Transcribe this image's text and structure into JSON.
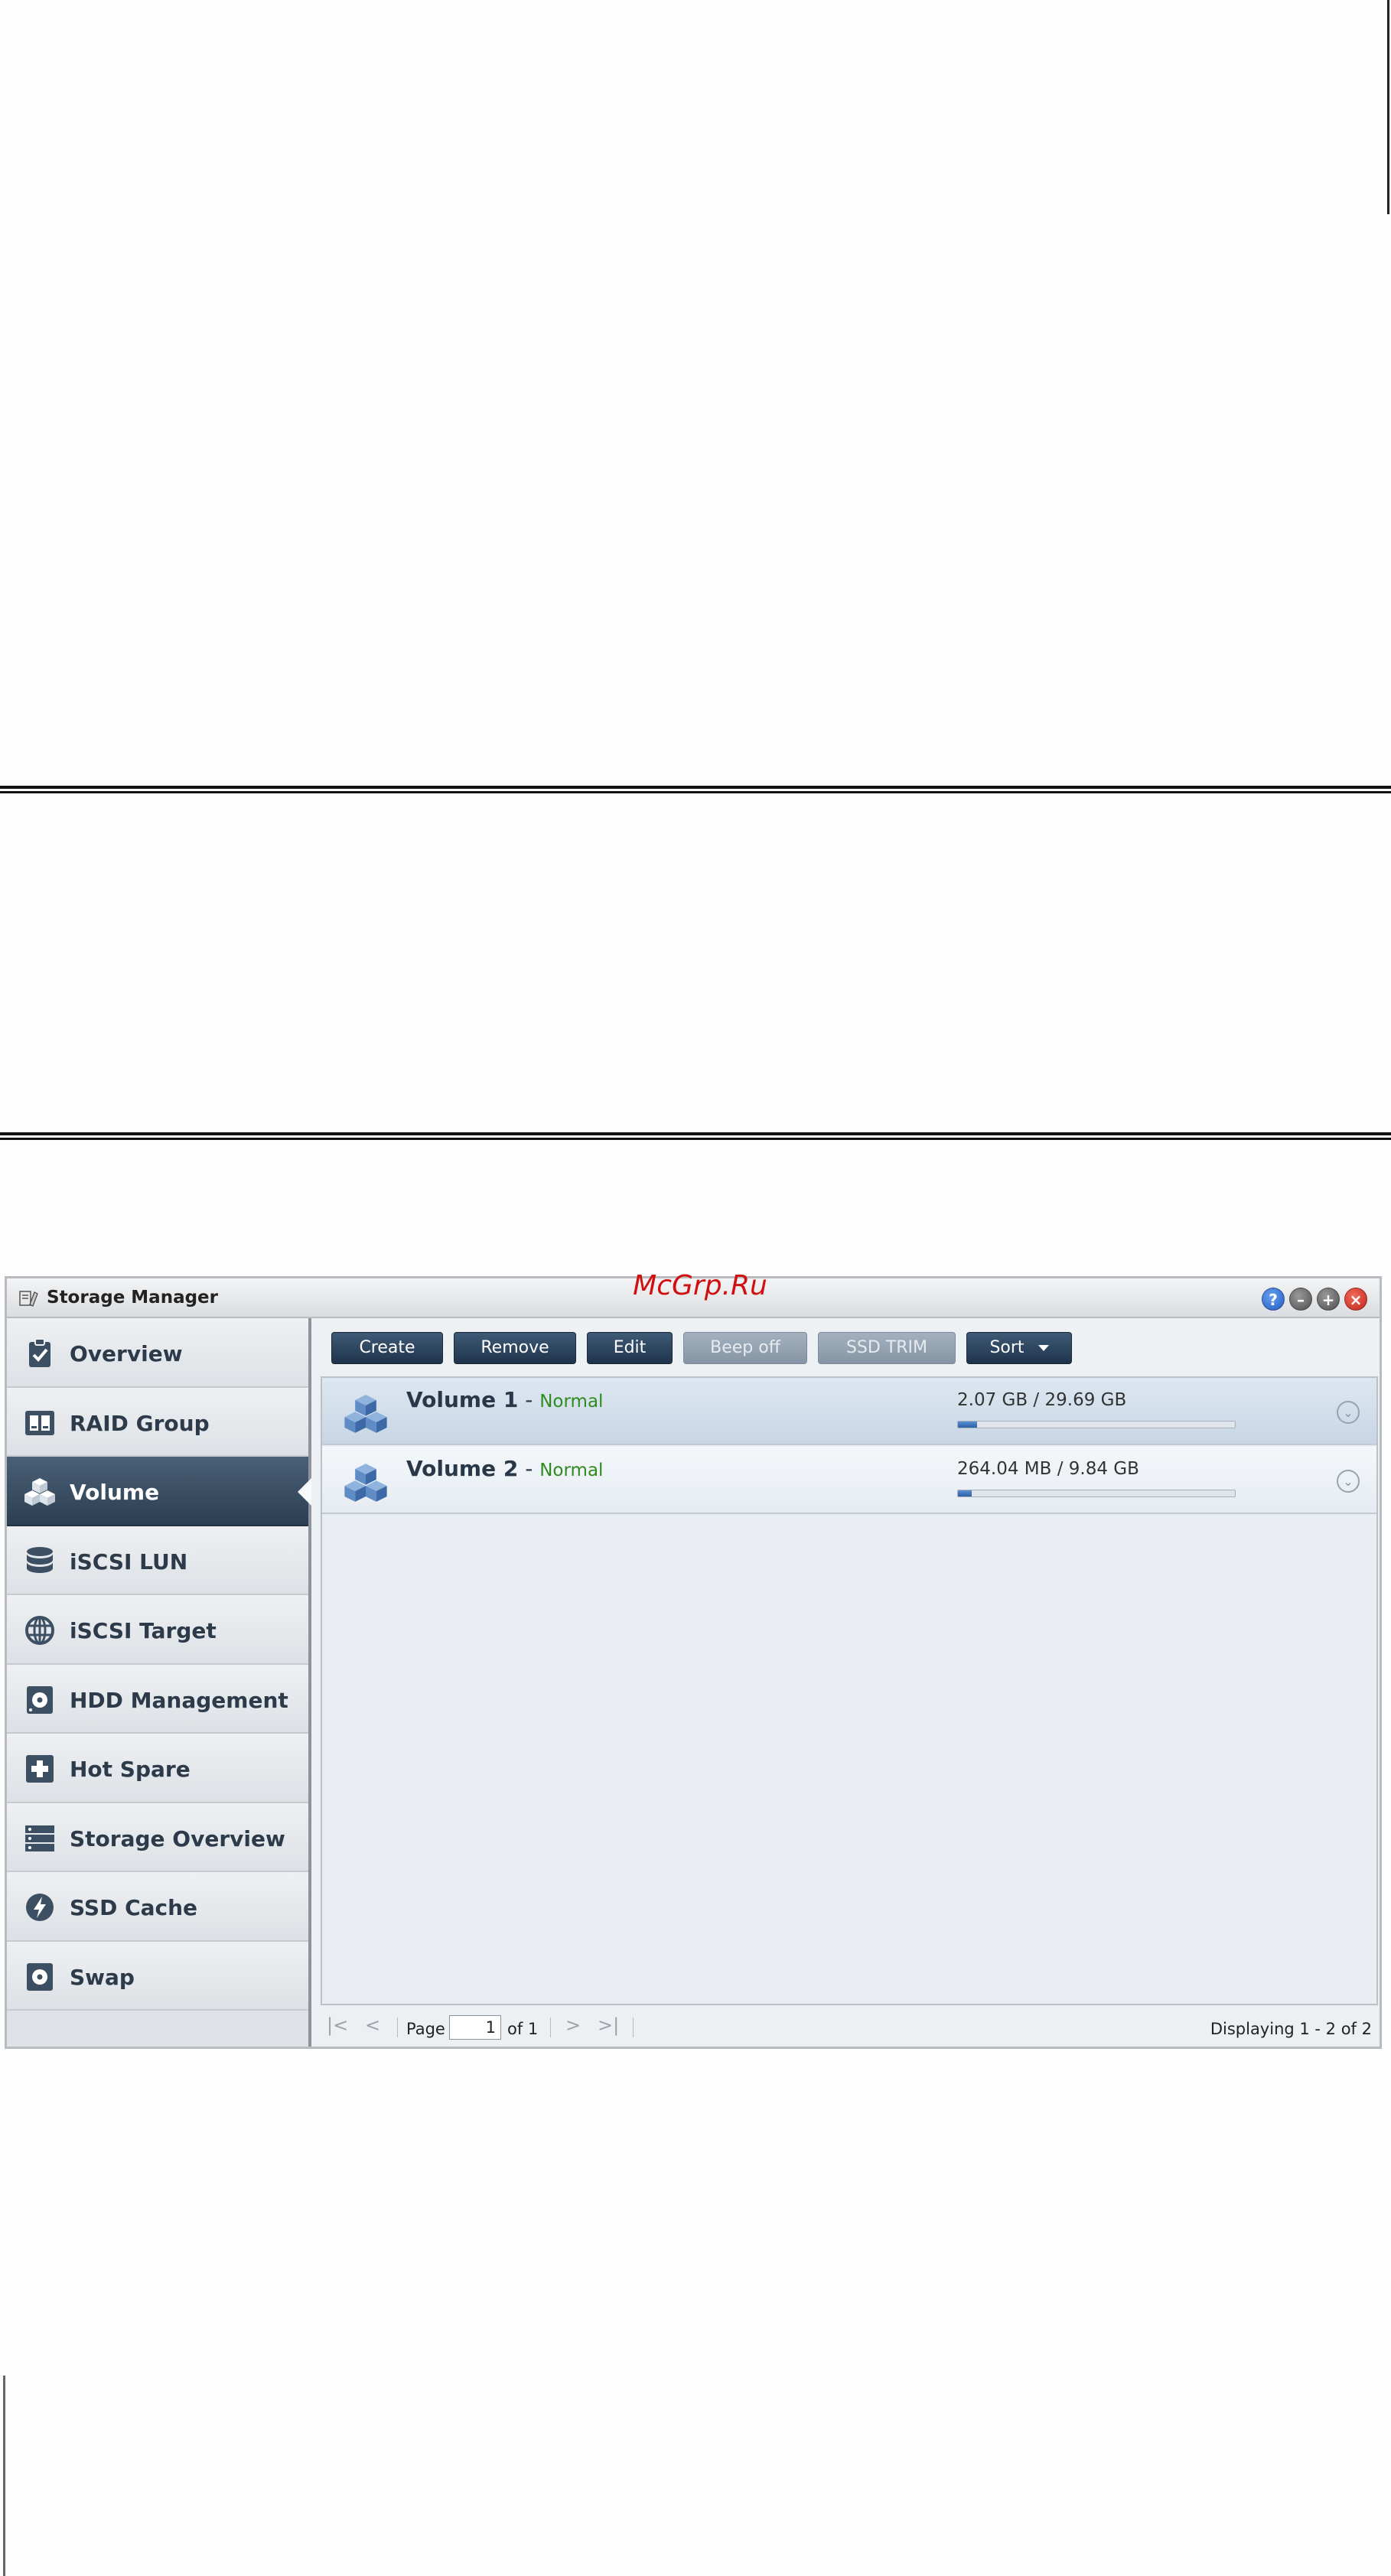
{
  "watermark": "McGrp.Ru",
  "window": {
    "title": "Storage Manager",
    "controls": [
      {
        "name": "help-icon",
        "glyph": "?"
      },
      {
        "name": "minimize-icon",
        "glyph": "–"
      },
      {
        "name": "maximize-icon",
        "glyph": "+"
      },
      {
        "name": "close-icon",
        "glyph": "×"
      }
    ]
  },
  "sidebar": {
    "items": [
      {
        "label": "Overview",
        "icon": "clipboard-check-icon"
      },
      {
        "label": "RAID Group",
        "icon": "raid-group-icon"
      },
      {
        "label": "Volume",
        "icon": "volume-cubes-icon",
        "active": true
      },
      {
        "label": "iSCSI LUN",
        "icon": "database-icon"
      },
      {
        "label": "iSCSI Target",
        "icon": "globe-icon"
      },
      {
        "label": "HDD Management",
        "icon": "hdd-icon"
      },
      {
        "label": "Hot Spare",
        "icon": "plus-box-icon"
      },
      {
        "label": "Storage Overview",
        "icon": "server-rack-icon"
      },
      {
        "label": "SSD Cache",
        "icon": "lightning-icon"
      },
      {
        "label": "Swap",
        "icon": "disk-icon"
      }
    ]
  },
  "toolbar": {
    "create": "Create",
    "remove": "Remove",
    "edit": "Edit",
    "beep_off": "Beep off",
    "ssd_trim": "SSD TRIM",
    "sort": "Sort"
  },
  "volumes": [
    {
      "name": "Volume 1",
      "separator": " - ",
      "status": "Normal",
      "size": "2.07 GB / 29.69 GB",
      "usage_fraction": 0.07
    },
    {
      "name": "Volume 2",
      "separator": " - ",
      "status": "Normal",
      "size": "264.04 MB / 9.84 GB",
      "usage_fraction": 0.05
    }
  ],
  "pager": {
    "page_label": "Page",
    "page_value": "1",
    "of_label": "of 1",
    "display": "Displaying 1 - 2 of 2"
  },
  "colors": {
    "accent_dark": "#2c3f52",
    "status_normal": "#2e8b1e",
    "progress": "#2c5fa8"
  }
}
